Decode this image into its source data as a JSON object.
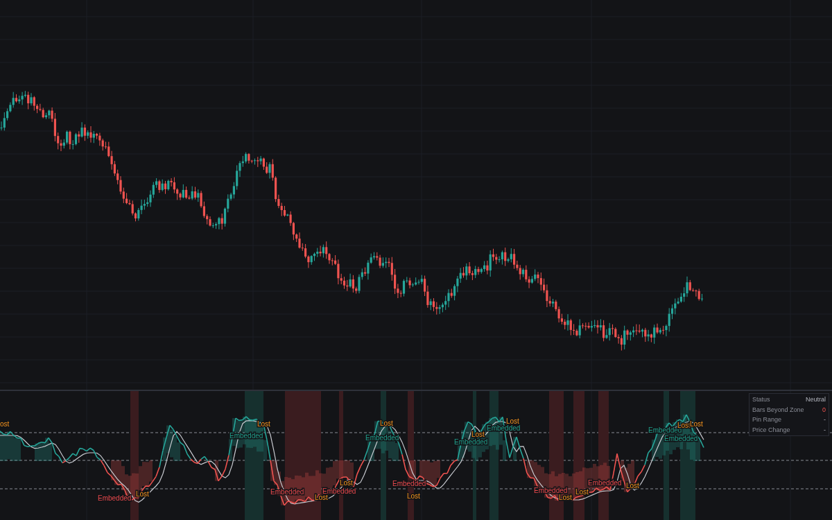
{
  "signals": [
    {
      "kind": "lost",
      "text": "ost"
    },
    {
      "kind": "embedded_bear",
      "text": "Embedded"
    },
    {
      "kind": "lost",
      "text": "Lost"
    },
    {
      "kind": "embedded_bull",
      "text": "Embedded"
    },
    {
      "kind": "lost",
      "text": "Lost"
    },
    {
      "kind": "embedded_bear",
      "text": "Embedded"
    },
    {
      "kind": "lost",
      "text": "Lost"
    },
    {
      "kind": "embedded_bear",
      "text": "Embedded"
    },
    {
      "kind": "lost",
      "text": "Lost"
    },
    {
      "kind": "lost",
      "text": "Lost"
    },
    {
      "kind": "embedded_bull",
      "text": "Embedded"
    },
    {
      "kind": "embedded_bear",
      "text": "Embedded"
    },
    {
      "kind": "lost",
      "text": "Lost"
    },
    {
      "kind": "embedded_bull",
      "text": "Embedded"
    },
    {
      "kind": "lost",
      "text": "Lost"
    },
    {
      "kind": "embedded_bull",
      "text": "Embedded"
    },
    {
      "kind": "lost",
      "text": "Lost"
    },
    {
      "kind": "embedded_bear",
      "text": "Embedded"
    },
    {
      "kind": "lost",
      "text": "Lost"
    },
    {
      "kind": "lost",
      "text": "Lost"
    },
    {
      "kind": "embedded_bear",
      "text": "Embedded"
    },
    {
      "kind": "lost",
      "text": "Lost"
    },
    {
      "kind": "embedded_bull",
      "text": "Embedded"
    },
    {
      "kind": "lost",
      "text": "Lost"
    },
    {
      "kind": "embedded_bull",
      "text": "Embedded"
    },
    {
      "kind": "lost",
      "text": "Lost"
    }
  ],
  "status_table": [
    {
      "label": "Status",
      "value": "Neutral",
      "kind": "plain"
    },
    {
      "label": "Bars Beyond Zone",
      "value": "0",
      "kind": "alert"
    },
    {
      "label": "Pin Range",
      "value": "-",
      "kind": "plain"
    },
    {
      "label": "Price Change",
      "value": "-",
      "kind": "plain"
    }
  ]
}
